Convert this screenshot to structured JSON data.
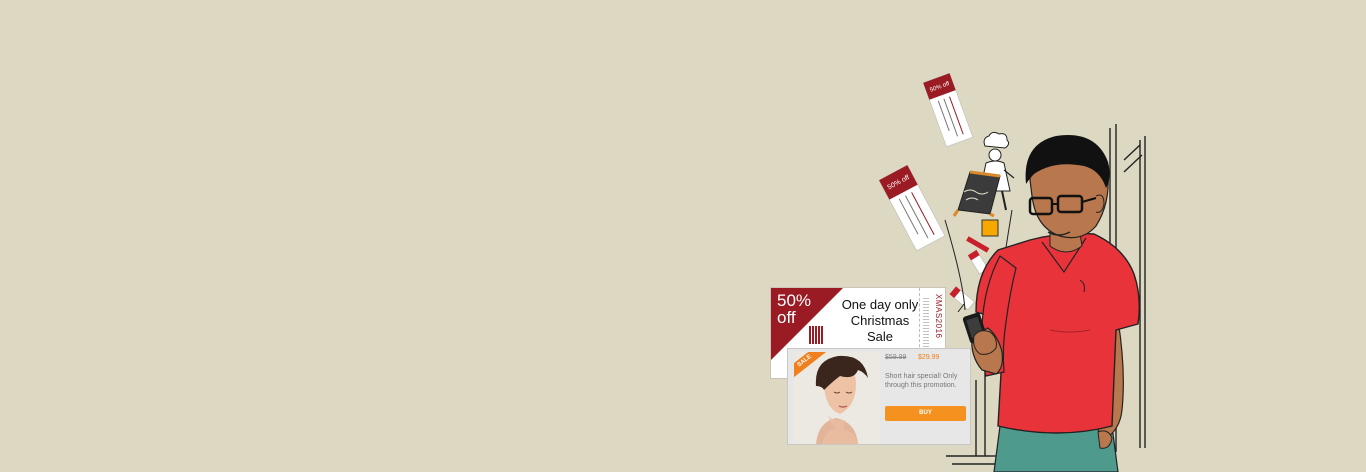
{
  "coupon": {
    "discount_line1": "50%",
    "discount_line2": "off",
    "headline_line1": "One day only",
    "headline_line2": "Christmas",
    "headline_line3": "Sale",
    "code": "XMAS2016"
  },
  "product_card": {
    "badge": "SALE",
    "old_price": "$59.99",
    "new_price": "$29.99",
    "description": "Short hair special! Only through this promotion.",
    "buy_label": "BUY"
  },
  "flying_coupons": {
    "top": "50% off",
    "middle": "50% off"
  },
  "colors": {
    "background": "#ddd8c1",
    "coupon_red": "#9a1b23",
    "accent_orange": "#f5911e",
    "shirt_red": "#e8333b",
    "pants_teal": "#4e9a8c",
    "skin": "#b8774c"
  }
}
